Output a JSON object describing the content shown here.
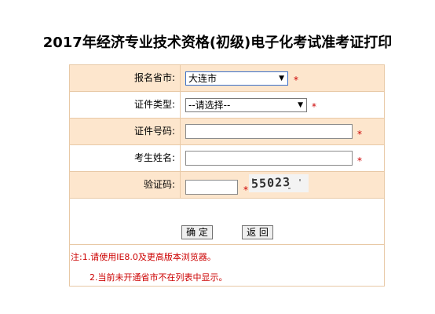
{
  "title": "2017年经济专业技术资格(初级)电子化考试准考证打印",
  "form": {
    "province_label": "报名省市:",
    "province_value": "大连市",
    "id_type_label": "证件类型:",
    "id_type_value": "--请选择--",
    "id_number_label": "证件号码:",
    "name_label": "考生姓名:",
    "captcha_label": "验证码:",
    "captcha_text": "55023",
    "required_mark": "*"
  },
  "buttons": {
    "confirm": "确 定",
    "back": "返 回"
  },
  "notes": {
    "line1": "注:1.请使用IE8.0及更高版本浏览器。",
    "line2": "2.当前未开通省市不在列表中显示。"
  }
}
